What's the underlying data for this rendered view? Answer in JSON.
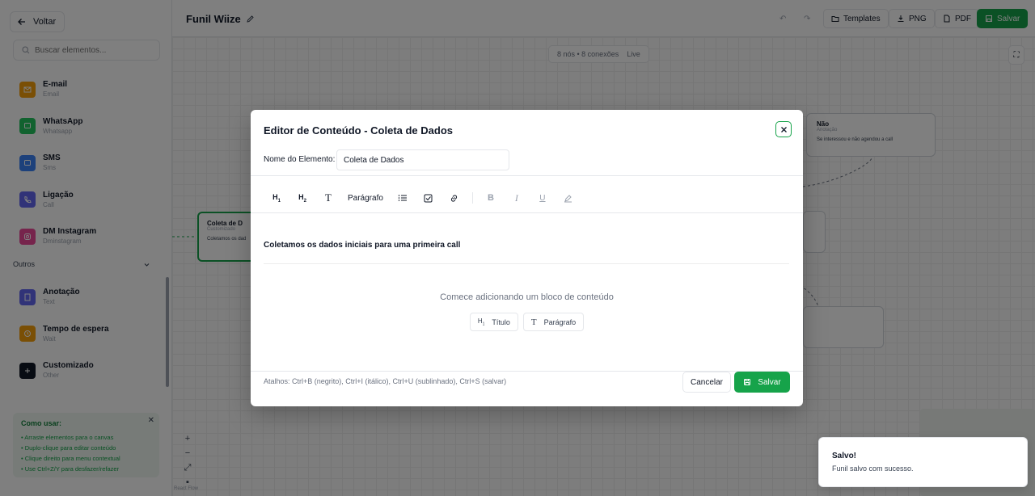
{
  "sidebar": {
    "back_label": "Voltar",
    "search_placeholder": "Buscar elementos...",
    "items": [
      {
        "name": "E-mail",
        "sub": "Email",
        "color": "#f59e0b"
      },
      {
        "name": "WhatsApp",
        "sub": "Whatsapp",
        "color": "#22c55e"
      },
      {
        "name": "SMS",
        "sub": "Sms",
        "color": "#3b82f6"
      },
      {
        "name": "Ligação",
        "sub": "Call",
        "color": "#6366f1"
      },
      {
        "name": "DM Instagram",
        "sub": "Dminstagram",
        "color": "#ec4899"
      }
    ],
    "group_label": "Outros",
    "items2": [
      {
        "name": "Anotação",
        "sub": "Text",
        "color": "#6366f1"
      },
      {
        "name": "Tempo de espera",
        "sub": "Wait",
        "color": "#f59e0b"
      },
      {
        "name": "Customizado",
        "sub": "Other",
        "color": "#111827"
      }
    ],
    "help": {
      "title": "Como usar:",
      "lines": [
        "• Arraste elementos para o canvas",
        "• Duplo-clique para editar conteúdo",
        "• Clique direito para menu contextual",
        "• Use Ctrl+Z/Y para desfazer/refazer"
      ]
    }
  },
  "topbar": {
    "title": "Funil Wiize",
    "templates_label": "Templates",
    "png_label": "PNG",
    "pdf_label": "PDF",
    "save_label": "Salvar"
  },
  "canvas": {
    "stats": "8 nós • 8 conexões",
    "stats_link": "Live",
    "node_left_title": "Coleta de D",
    "node_left_sub": "Customizado",
    "node_left_text": "Coletamos os dad",
    "node_right_title": "Não",
    "node_right_sub": "Anotação",
    "node_right_text": "Se interessou e não agendou a call",
    "attribution": "React Flow"
  },
  "modal": {
    "title": "Editor de Conteúdo - Coleta de Dados",
    "name_label": "Nome do Elemento:",
    "name_value": "Coleta de Dados",
    "toolbar": {
      "h1": "H1",
      "h2": "H2",
      "text": "T",
      "paragraph": "Parágrafo"
    },
    "content_title": "Coletamos os dados iniciais para uma primeira call",
    "empty_hint": "Comece adicionando um bloco de conteúdo",
    "add_title_label": "Título",
    "add_paragraph_label": "Parágrafo",
    "shortcuts": "Atalhos: Ctrl+B (negrito), Ctrl+I (itálico), Ctrl+U (sublinhado), Ctrl+S (salvar)",
    "cancel_label": "Cancelar",
    "save_label": "Salvar"
  },
  "toast": {
    "title": "Salvo!",
    "description": "Funil salvo com sucesso."
  },
  "colors": {
    "accent": "#16a34a",
    "overlay": "rgba(0,0,0,0.5)"
  }
}
